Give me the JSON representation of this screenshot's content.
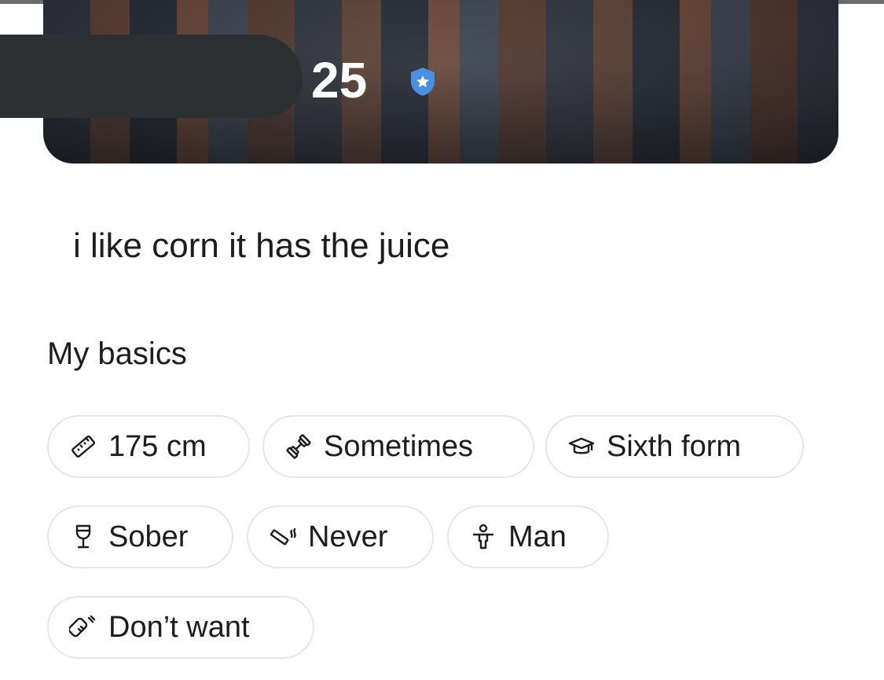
{
  "profile": {
    "age": "25",
    "bio": "i like corn it has the juice"
  },
  "basics": {
    "title": "My basics",
    "chips": [
      {
        "icon": "ruler-icon",
        "label": "175 cm"
      },
      {
        "icon": "dumbbell-icon",
        "label": "Sometimes"
      },
      {
        "icon": "graduation-cap-icon",
        "label": "Sixth form"
      },
      {
        "icon": "wine-glass-icon",
        "label": "Sober"
      },
      {
        "icon": "cigarette-icon",
        "label": "Never"
      },
      {
        "icon": "person-icon",
        "label": "Man"
      },
      {
        "icon": "baby-bottle-icon",
        "label": "Don’t want"
      }
    ]
  },
  "colors": {
    "verified_badge": "#4a90e2",
    "chip_border": "#e6e6e8",
    "text": "#1d1d1d",
    "redaction": "#2d3033"
  }
}
